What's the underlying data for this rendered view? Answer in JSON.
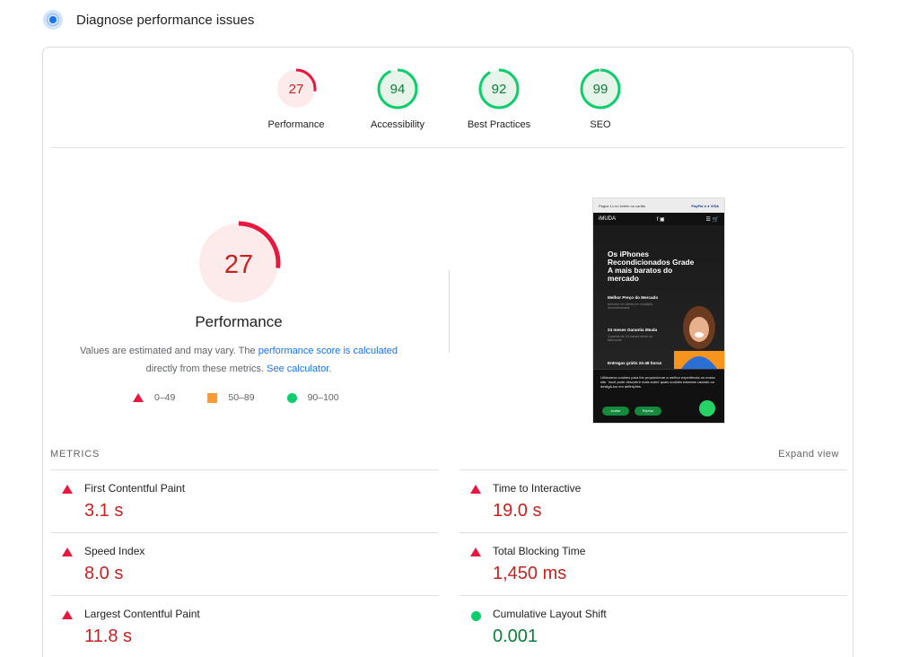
{
  "header": {
    "title": "Diagnose performance issues",
    "icon": "lighthouse-icon"
  },
  "categories": [
    {
      "label": "Performance",
      "score": 27,
      "color": "#e8173d",
      "bg": "#fdebeb",
      "text": "#c5221f"
    },
    {
      "label": "Accessibility",
      "score": 94,
      "color": "#0cce6b",
      "bg": "#e6f4ea",
      "text": "#0d7d3a"
    },
    {
      "label": "Best Practices",
      "score": 92,
      "color": "#0cce6b",
      "bg": "#e6f4ea",
      "text": "#0d7d3a"
    },
    {
      "label": "SEO",
      "score": 99,
      "color": "#0cce6b",
      "bg": "#e6f4ea",
      "text": "#0d7d3a"
    }
  ],
  "performance": {
    "score": 27,
    "title": "Performance",
    "desc_part1": "Values are estimated and may vary. The ",
    "desc_link1": "performance score is calculated",
    "desc_part2": " directly from these metrics. ",
    "desc_link2": "See calculator."
  },
  "legend": [
    {
      "icon": "triangle-icon",
      "range": "0–49",
      "color": "#e8173d"
    },
    {
      "icon": "square-icon",
      "range": "50–89",
      "color": "#fa9a30"
    },
    {
      "icon": "circle-icon",
      "range": "90–100",
      "color": "#0cce6b"
    }
  ],
  "screenshot": {
    "topbar": "Pague 1x no boleto ou cartão",
    "brand": "iMUDA",
    "headline": "Os iPhones Recondicionados Grade A mais baratos do mercado",
    "feature1": "Melhor Preço do Mercado",
    "feature1_sub": "Iphones em oferta em condição recondicionada",
    "feature2": "24 meses Garantia iMuda",
    "feature2_sub": "Garantia de 24 meses direto do fabricante",
    "feature3": "Entregas grátis 24-48 horas",
    "cookie": "Utilizamos cookies para lhe proporcionar a melhor experiência no nosso site. Você pode descobrir mais sobre quais cookies estamos usando ou desligá-los em definições.",
    "accept": "Aceitar",
    "reject": "Rejeitar"
  },
  "metrics": {
    "heading": "METRICS",
    "expand": "Expand view",
    "items": [
      {
        "label": "First Contentful Paint",
        "value": "3.1 s",
        "status": "poor"
      },
      {
        "label": "Time to Interactive",
        "value": "19.0 s",
        "status": "poor"
      },
      {
        "label": "Speed Index",
        "value": "8.0 s",
        "status": "poor"
      },
      {
        "label": "Total Blocking Time",
        "value": "1,450 ms",
        "status": "poor"
      },
      {
        "label": "Largest Contentful Paint",
        "value": "11.8 s",
        "status": "poor"
      },
      {
        "label": "Cumulative Layout Shift",
        "value": "0.001",
        "status": "good"
      }
    ]
  }
}
